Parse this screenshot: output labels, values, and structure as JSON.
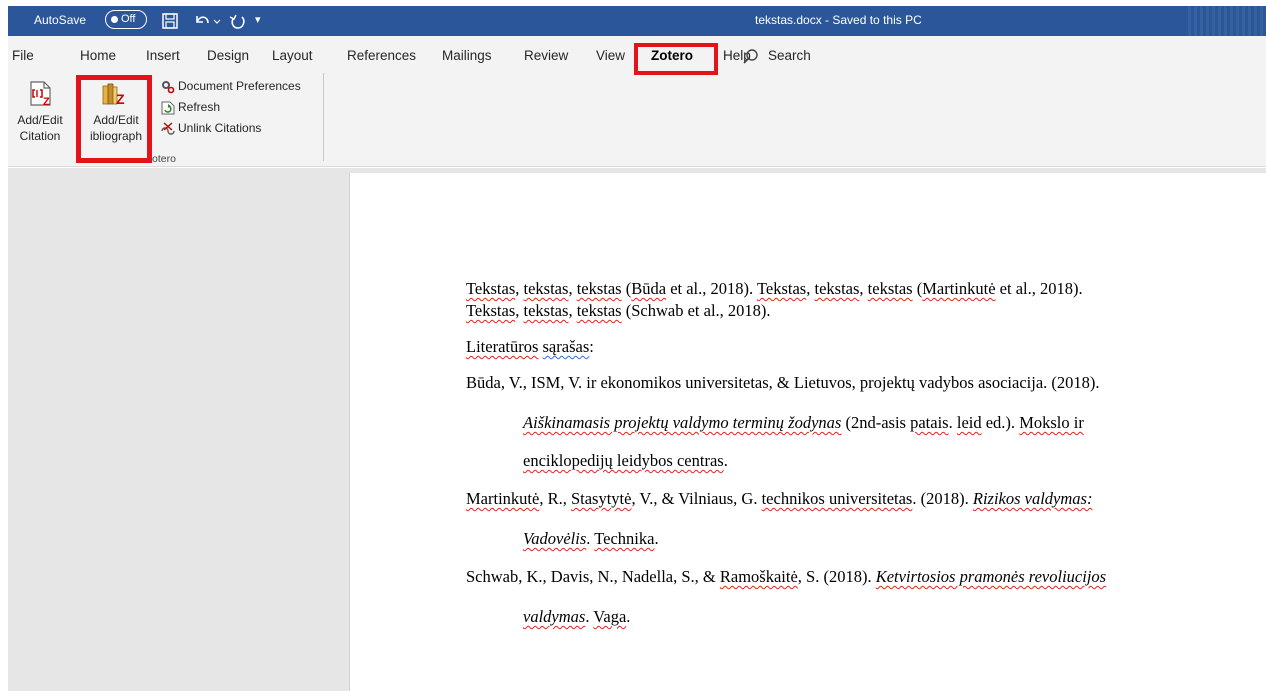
{
  "titlebar": {
    "autosave_label": "AutoSave",
    "autosave_state": "Off",
    "document_title": "tekstas.docx - Saved to this PC"
  },
  "ribbon": {
    "tabs": [
      {
        "label": "File"
      },
      {
        "label": "Home"
      },
      {
        "label": "Insert"
      },
      {
        "label": "Design"
      },
      {
        "label": "Layout"
      },
      {
        "label": "References"
      },
      {
        "label": "Mailings"
      },
      {
        "label": "Review"
      },
      {
        "label": "View"
      },
      {
        "label": "Zotero",
        "active": true
      },
      {
        "label": "Help"
      }
    ],
    "search_label": "Search",
    "zotero_group": {
      "add_edit_citation": [
        "Add/Edit",
        "Citation"
      ],
      "add_edit_bibliography": [
        "Add/Edit",
        "ibliograph"
      ],
      "document_preferences": "Document Preferences",
      "refresh": "Refresh",
      "unlink_citations": "Unlink Citations",
      "group_label": "otero"
    },
    "highlight_color": "#e3131b",
    "accent_color": "#2b579a"
  },
  "document": {
    "para1": {
      "w1": "Tekstas",
      "p1": ", ",
      "w2": "tekstas",
      "p2": ", ",
      "w3": "tekstas",
      "p3": " (",
      "w4": "Būda",
      "p4": " et al., 2018). ",
      "w5": "Tekstas",
      "p5": ", ",
      "w6": "tekstas",
      "p6": ", ",
      "w7": "tekstas",
      "p7": " (",
      "w8": "Martinkutė",
      "p8": " et al., 2018)."
    },
    "para1_line2": {
      "w1": "Tekstas",
      "p1": ", ",
      "w2": "tekstas",
      "p2": ", ",
      "w3": "tekstas",
      "p3": " (Schwab et al., 2018)."
    },
    "heading": {
      "w1": "Literatūros",
      "p1": " ",
      "w2": "sąrašas",
      "p2": ":"
    },
    "ref1": {
      "line1": "Būda, V., ISM, V. ir ekonomikos universitetas, & Lietuvos,  projektų vadybos asociacija. (2018).",
      "line2": {
        "it1": "Aiškinamasis projektų valdymo terminų žodynas",
        "t1": " (2nd-asis ",
        "s1": "patais",
        "t2": ". ",
        "s2": "leid",
        "t3": " ed.). ",
        "s3": "Mokslo ir"
      },
      "line3": {
        "s1": "enciklopedijų leidybos centras",
        "t1": "."
      }
    },
    "ref2": {
      "line1": {
        "s1": "Martinkutė",
        "t1": ", R., ",
        "s2": "Stasytytė",
        "t2": ", V., & Vilniaus, G. ",
        "s3": "technikos universitetas",
        "t3": ". (2018). ",
        "it1": "Rizikos valdymas:"
      },
      "line2": {
        "it1": "Vadovėlis",
        "t1": ". ",
        "s1": "Technika",
        "t2": "."
      }
    },
    "ref3": {
      "line1": {
        "t1": "Schwab, K., Davis, N., Nadella, S., & ",
        "s1": "Ramoškaitė",
        "t2": ", S. (2018). ",
        "it1": "Ketvirtosios pramonės revoliucijos"
      },
      "line2": {
        "it1": "valdymas",
        "t1": ". ",
        "s1": "Vaga",
        "t2": "."
      }
    }
  }
}
